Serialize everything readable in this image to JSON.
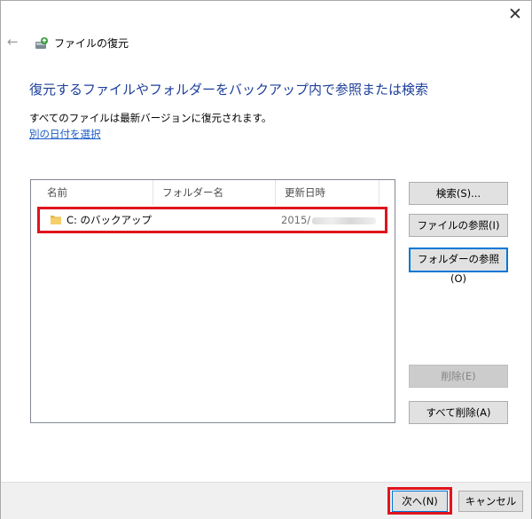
{
  "window": {
    "close_glyph": "✕",
    "back_glyph": "←",
    "title": "ファイルの復元"
  },
  "content": {
    "heading": "復元するファイルやフォルダーをバックアップ内で参照または検索",
    "description": "すべてのファイルは最新バージョンに復元されます。",
    "choose_date_link": "別の日付を選択"
  },
  "file_list": {
    "columns": [
      "名前",
      "フォルダー名",
      "更新日時"
    ],
    "rows": [
      {
        "name": "C: のバックアップ",
        "folder": "",
        "modified": "2015/"
      }
    ]
  },
  "side_buttons": {
    "search": "検索(S)...",
    "browse_files": "ファイルの参照(I)",
    "browse_folders": "フォルダーの参照(O)",
    "delete": "削除(E)",
    "delete_all": "すべて削除(A)"
  },
  "footer": {
    "next": "次へ(N)",
    "cancel": "キャンセル"
  },
  "colors": {
    "heading": "#1d3f9a",
    "link": "#1a5cc6",
    "highlight": "#e0141e",
    "focus": "#0078d7",
    "folder": "#e8b84a"
  },
  "icons": {
    "app": "backup-restore-icon",
    "back": "back-arrow-icon",
    "close": "close-icon",
    "row": "folder-icon"
  }
}
